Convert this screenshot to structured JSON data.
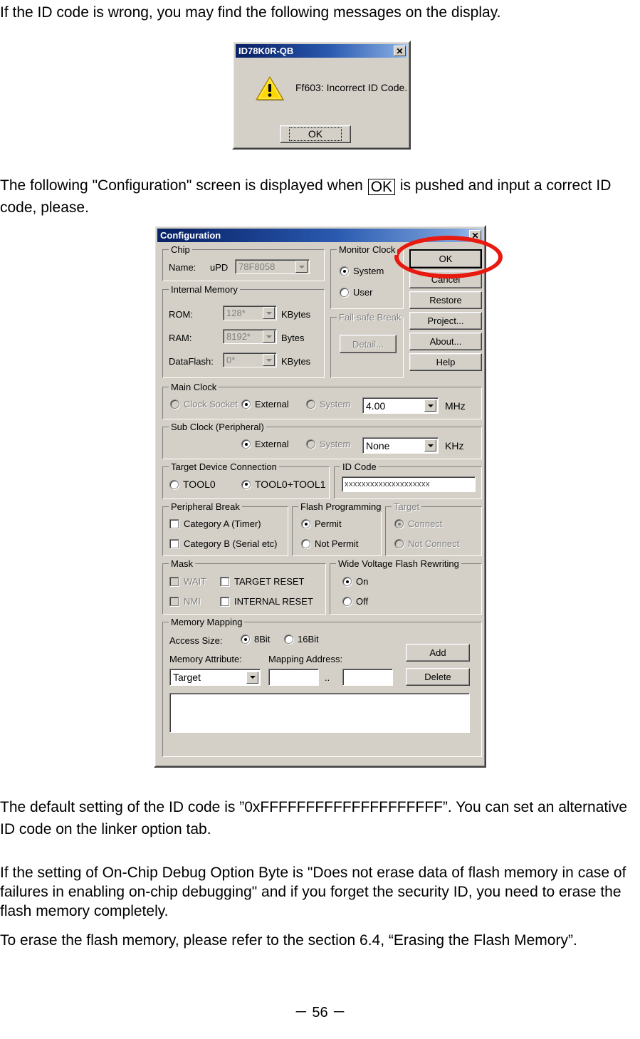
{
  "document": {
    "intro_line": "If the ID code is wrong, you may find the following messages on the display.",
    "config_line_pre": "The following \"Configuration\" screen is displayed when ",
    "config_line_boxed": "OK",
    "config_line_post": " is pushed and input a correct ID code, please.",
    "default_id_note": "The default setting of the ID code is ”0xFFFFFFFFFFFFFFFFFFFF”. You can set an alternative ID code on the linker option tab.",
    "onchip_note": "If the setting of On-Chip Debug Option Byte is \"Does not erase data of flash memory in case of failures in enabling on-chip debugging\" and if you forget the security ID, you need to erase the flash memory completely.",
    "erase_note": "To erase the flash memory, please refer to the section 6.4, “Erasing the Flash Memory”.",
    "page_number": "－ 56 －"
  },
  "message_box": {
    "title": "ID78K0R-QB",
    "close_label": "✕",
    "icon": "warning-triangle-icon",
    "message": "Ff603: Incorrect ID Code.",
    "ok_label": "OK"
  },
  "config_dialog": {
    "title": "Configuration",
    "close_label": "✕",
    "chip": {
      "legend": "Chip",
      "name_label": "Name:",
      "prefix": "uPD",
      "value": "78F8058"
    },
    "internal_memory": {
      "legend": "Internal Memory",
      "rom_label": "ROM:",
      "rom_value": "128*",
      "rom_unit": "KBytes",
      "ram_label": "RAM:",
      "ram_value": "8192*",
      "ram_unit": "Bytes",
      "dataflash_label": "DataFlash:",
      "dataflash_value": "0*",
      "dataflash_unit": "KBytes"
    },
    "monitor_clock": {
      "legend": "Monitor Clock",
      "options": [
        "System",
        "User"
      ],
      "selected": "System"
    },
    "failsafe_break": {
      "legend": "Fail-safe Break",
      "detail_label": "Detail..."
    },
    "buttons": [
      "OK",
      "Cancel",
      "Restore",
      "Project...",
      "About...",
      "Help"
    ],
    "main_clock": {
      "legend": "Main Clock",
      "options": [
        "Clock Socket",
        "External",
        "System"
      ],
      "selected": "External",
      "value": "4.00",
      "unit": "MHz"
    },
    "sub_clock": {
      "legend": "Sub Clock (Peripheral)",
      "options": [
        "External",
        "System"
      ],
      "selected": "External",
      "value": "None",
      "unit": "KHz"
    },
    "target_device_connection": {
      "legend": "Target Device Connection",
      "options": [
        "TOOL0",
        "TOOL0+TOOL1"
      ],
      "selected": "TOOL0+TOOL1"
    },
    "id_code": {
      "legend": "ID Code",
      "value": "xxxxxxxxxxxxxxxxxxxx"
    },
    "peripheral_break": {
      "legend": "Peripheral Break",
      "items": [
        "Category A (Timer)",
        "Category B (Serial etc)"
      ]
    },
    "flash_programming": {
      "legend": "Flash Programming",
      "options": [
        "Permit",
        "Not Permit"
      ],
      "selected": "Permit"
    },
    "target": {
      "legend": "Target",
      "options": [
        "Connect",
        "Not Connect"
      ],
      "selected": "Connect"
    },
    "mask": {
      "legend": "Mask",
      "items": [
        "WAIT",
        "TARGET RESET",
        "NMI",
        "INTERNAL RESET"
      ]
    },
    "wide_voltage": {
      "legend": "Wide Voltage Flash Rewriting",
      "options": [
        "On",
        "Off"
      ],
      "selected": "On"
    },
    "memory_mapping": {
      "legend": "Memory Mapping",
      "access_size_label": "Access Size:",
      "access_options": [
        "8Bit",
        "16Bit"
      ],
      "access_selected": "8Bit",
      "memory_attribute_label": "Memory Attribute:",
      "memory_attribute_value": "Target",
      "mapping_address_label": "Mapping Address:",
      "address_from": "",
      "address_separator": "..",
      "address_to": "",
      "add_label": "Add",
      "delete_label": "Delete"
    }
  },
  "colors": {
    "annotation": "#e8190f",
    "title_bar": "#0a246a",
    "face": "#d4d0c8"
  }
}
